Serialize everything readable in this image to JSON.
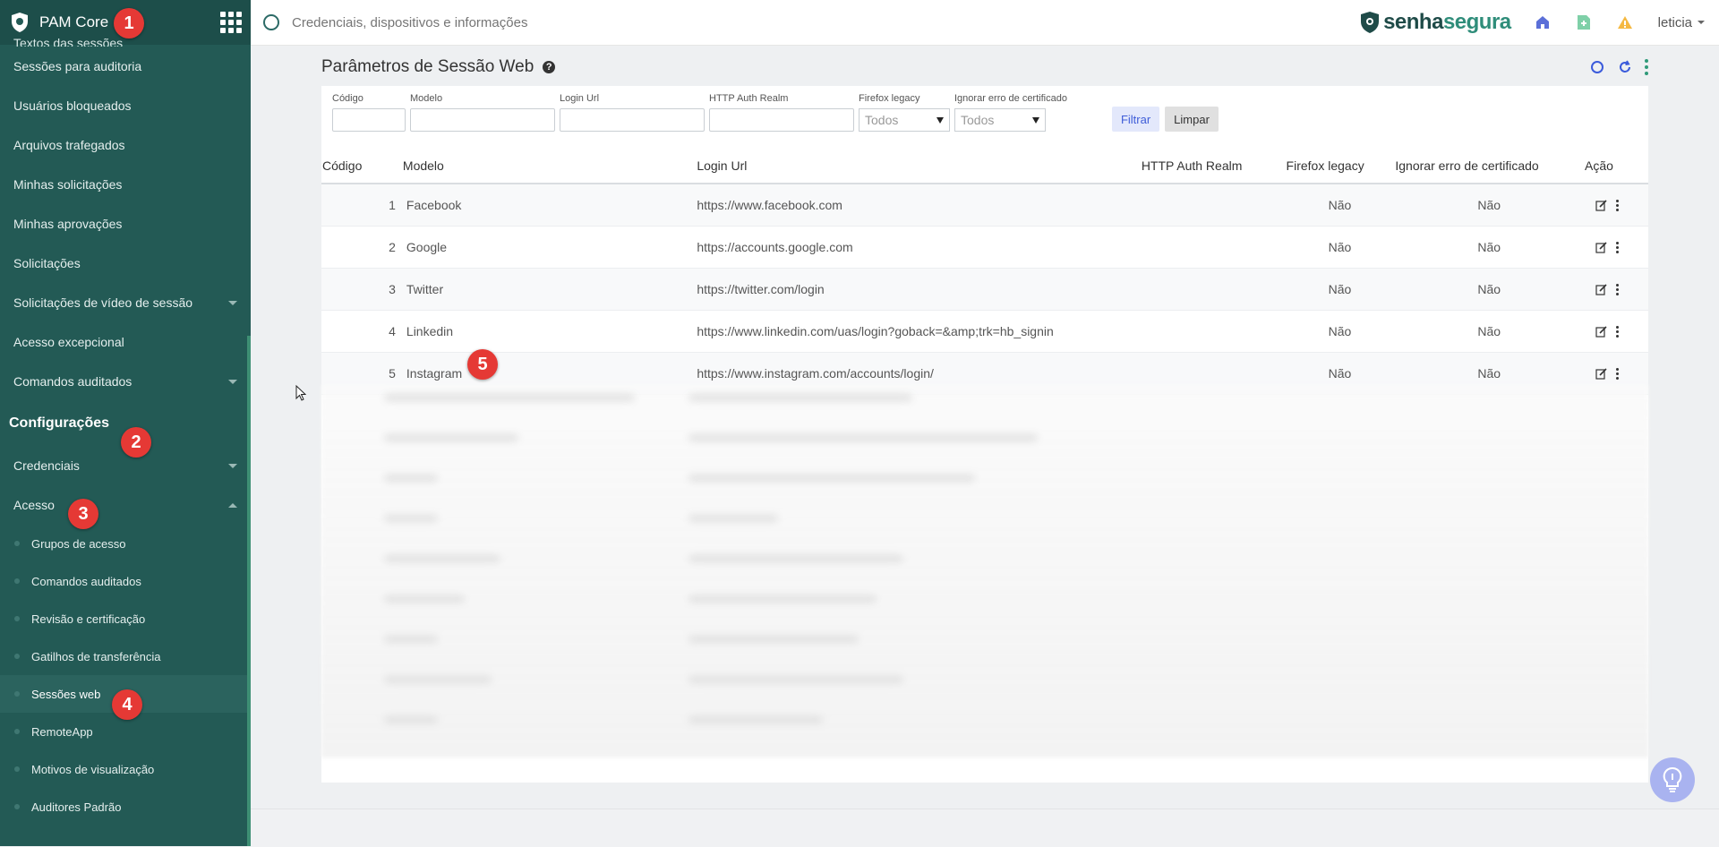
{
  "sidebar": {
    "brand": "PAM Core",
    "cut_item": "Textos das sessões",
    "items": [
      {
        "label": "Sessões para auditoria",
        "caret": false
      },
      {
        "label": "Usuários bloqueados",
        "caret": false
      },
      {
        "label": "Arquivos trafegados",
        "caret": false
      },
      {
        "label": "Minhas solicitações",
        "caret": false
      },
      {
        "label": "Minhas aprovações",
        "caret": false
      },
      {
        "label": "Solicitações",
        "caret": false
      },
      {
        "label": "Solicitações de vídeo de sessão",
        "caret": true
      },
      {
        "label": "Acesso excepcional",
        "caret": false
      },
      {
        "label": "Comandos auditados",
        "caret": true
      }
    ],
    "section": "Configurações",
    "section_items": [
      {
        "label": "Credenciais",
        "caret": "down"
      },
      {
        "label": "Acesso",
        "caret": "up"
      }
    ],
    "sub_items": [
      {
        "label": "Grupos de acesso",
        "active": false
      },
      {
        "label": "Comandos auditados",
        "active": false
      },
      {
        "label": "Revisão e certificação",
        "active": false
      },
      {
        "label": "Gatilhos de transferência",
        "active": false
      },
      {
        "label": "Sessões web",
        "active": true
      },
      {
        "label": "RemoteApp",
        "active": false
      },
      {
        "label": "Motivos de visualização",
        "active": false
      },
      {
        "label": "Auditores Padrão",
        "active": false
      }
    ]
  },
  "topbar": {
    "search_placeholder": "Credenciais, dispositivos e informações",
    "logo_senha": "senha",
    "logo_segura": "segura",
    "user": "leticia"
  },
  "page": {
    "title": "Parâmetros de Sessão Web"
  },
  "filters": {
    "codigo": "Código",
    "modelo": "Modelo",
    "login_url": "Login Url",
    "realm": "HTTP Auth Realm",
    "firefox": "Firefox legacy",
    "cert": "Ignorar erro de certificado",
    "firefox_value": "Todos",
    "cert_value": "Todos",
    "btn_filter": "Filtrar",
    "btn_clear": "Limpar"
  },
  "table": {
    "headers": [
      "Código",
      "Modelo",
      "Login Url",
      "HTTP Auth Realm",
      "Firefox legacy",
      "Ignorar erro de certificado",
      "Ação"
    ],
    "rows": [
      {
        "code": "1",
        "model": "Facebook",
        "url": "https://www.facebook.com",
        "realm": "",
        "firefox": "Não",
        "cert": "Não"
      },
      {
        "code": "2",
        "model": "Google",
        "url": "https://accounts.google.com",
        "realm": "",
        "firefox": "Não",
        "cert": "Não"
      },
      {
        "code": "3",
        "model": "Twitter",
        "url": "https://twitter.com/login",
        "realm": "",
        "firefox": "Não",
        "cert": "Não"
      },
      {
        "code": "4",
        "model": "Linkedin",
        "url": "https://www.linkedin.com/uas/login?goback=&amp;trk=hb_signin",
        "realm": "",
        "firefox": "Não",
        "cert": "Não"
      },
      {
        "code": "5",
        "model": "Instagram",
        "url": "https://www.instagram.com/accounts/login/",
        "realm": "",
        "firefox": "Não",
        "cert": "Não"
      }
    ]
  },
  "markers": [
    "1",
    "2",
    "3",
    "4",
    "5"
  ],
  "colors": {
    "sidebar": "#235a55",
    "accent_blue": "#3f5dd8",
    "marker": "#e53935",
    "brand_green": "#2f8d7a"
  }
}
